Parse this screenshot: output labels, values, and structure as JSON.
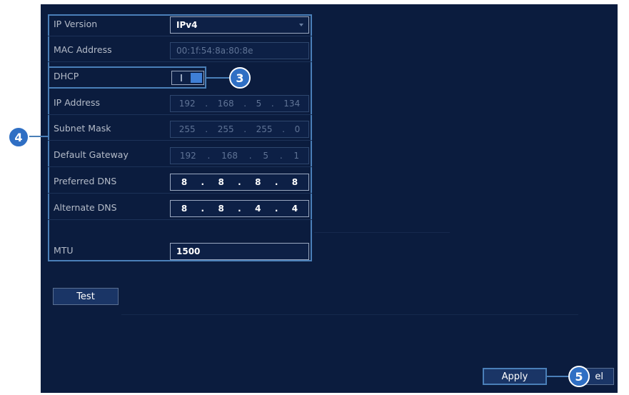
{
  "form": {
    "ip_version": {
      "label": "IP Version",
      "value": "IPv4"
    },
    "mac_address": {
      "label": "MAC Address",
      "value": "00:1f:54:8a:80:8e"
    },
    "dhcp": {
      "label": "DHCP",
      "toggle": "I"
    },
    "ip_address": {
      "label": "IP Address",
      "octets": [
        "192",
        "168",
        "5",
        "134"
      ]
    },
    "subnet_mask": {
      "label": "Subnet Mask",
      "octets": [
        "255",
        "255",
        "255",
        "0"
      ]
    },
    "default_gateway": {
      "label": "Default Gateway",
      "octets": [
        "192",
        "168",
        "5",
        "1"
      ]
    },
    "preferred_dns": {
      "label": "Preferred DNS",
      "octets": [
        "8",
        "8",
        "8",
        "8"
      ]
    },
    "alternate_dns": {
      "label": "Alternate DNS",
      "octets": [
        "8",
        "8",
        "4",
        "4"
      ]
    },
    "mtu": {
      "label": "MTU",
      "value": "1500"
    }
  },
  "buttons": {
    "test": "Test",
    "apply": "Apply",
    "cancel_partial": "el"
  },
  "callouts": {
    "c3": "3",
    "c4": "4",
    "c5": "5"
  },
  "ip_separator": ".",
  "colors": {
    "background": "#0b1c3e",
    "accent": "#2f6fc4",
    "border": "#4a7fb8"
  }
}
